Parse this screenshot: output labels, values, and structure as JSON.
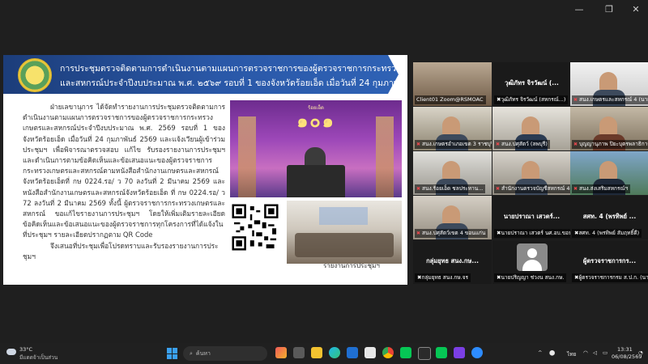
{
  "window": {
    "minimize": "—",
    "maximize": "❐",
    "close": "✕"
  },
  "slide": {
    "banner_line1": "การประชุมตรวจติดตามการดำเนินงานตามแผนการตรวจราชการของผู้ตรวจราชการกระทรวงเกษตร",
    "banner_line2": "และสหกรณ์ประจำปีงบประมาณ พ.ศ. ๒๕๖๙ รอบที่ 1 ของจังหวัดร้อยเอ็ด เมื่อวันที่ 24 กุมภาพันธ์ 2569",
    "paragraphs": [
      "ฝ่ายเลขานุการ ได้จัดทำรายงานการประชุมตรวจติดตามการดำเนินงานตามแผนการตรวจราชการของผู้ตรวจราชการกระทรวงเกษตรและสหกรณ์ประจำปีงบประมาณ พ.ศ. 2569 รอบที่ 1 ของจังหวัดร้อยเอ็ด เมื่อวันที่ 24 กุมภาพันธ์ 2569 และแจ้งเวียนผู้เข้าร่วมประชุมฯ เพื่อพิจารณาตรวจสอบ แก้ไข รับรองรายงานการประชุมฯ และดำเนินการตามข้อคิดเห็นและข้อเสนอแนะของผู้ตรวจราชการกระทรวงเกษตรและสหกรณ์ตามหนังสือสำนักงานเกษตรและสหกรณ์จังหวัดร้อยเอ็ดที่ กษ 0224.รอ/ ว 70 ลงวันที่ 2 มีนาคม 2569 และหนังสือสำนักงานเกษตรและสหกรณ์จังหวัดร้อยเอ็ด ที่ กษ 0224.รอ/ ว 72 ลงวันที่ 2 มีนาคม 2569 ทั้งนี้ ผู้ตรวจราชการกระทรวงเกษตรและสหกรณ์ ขอแก้ไขรายงานการประชุมฯ โดยให้เพิ่มเติมรายละเอียดข้อคิดเห็นและข้อเสนอแนะของผู้ตรวจราชการทุกโครงการที่ได้แจ้งในที่ประชุมฯ รายละเอียดปรากฏตาม QR Code",
      "จึงเสนอที่ประชุมเพื่อโปรดทราบและรับรองรายงานการประชุมฯ"
    ],
    "event_top": "ร้อยเอ็ด",
    "event_number": "๑๐๑",
    "caption": "รายงานการประชุมฯ"
  },
  "tiles": [
    {
      "label": "Client01 Zoom@RSMOAC"
    },
    {
      "label": "วุฒิภัทร จิรวัฒน์ (สหกรณ์...)"
    },
    {
      "label": "สนง.เกษตรและสหกรณ์ 4 (นายปร..."
    },
    {
      "label": "สนง.เกษตรอำเภอเขต 3 ราชบุรี"
    },
    {
      "label": "สนง.ปศุสัตว์ (ลพบุรี)"
    },
    {
      "label": "บุญญานุภาพ ปิยะบุตรพลาธิการ 12"
    },
    {
      "label": "สนง.ร้อยเอ็ด ชลประทาน..."
    },
    {
      "label": "สำนักงานตรวจบัญชีสหกรณ์ 4 ..."
    },
    {
      "label": "สนง.ส่งเสริมสหกรณ์ฯ"
    },
    {
      "label": "สนง.ปศุสัตว์เขต 4 ขอนแก่น"
    }
  ],
  "name_tiles": [
    {
      "top": "วุฒิภัทร จิรวัฒน์ (...",
      "label": "วุฒิภัทร จิรวัฒน์ (สหกรณ์...)"
    },
    {
      "top": "นายปราณา เสวตร์...",
      "label": "นายปราณา เสวตร์ นศ.อบ.ขอนแก่น..."
    },
    {
      "top": "สศท. 4 (พรทิพย์ ...",
      "label": "สศท. 4 (พรทิพย์ สัมฤทธิ์ดี)"
    },
    {
      "top": "กลุ่มยุทธ สนง.กษ...",
      "label": "กลุ่มยุทธ สนง.กษ.จร"
    },
    {
      "top": "",
      "label": "นายปริญญา ช่วงน สนง.กษ."
    },
    {
      "top": "ผู้ตรวจราชการกร...",
      "label": "ผู้ตรวจราชการกรม ส.ป.ก. (นาย..."
    }
  ],
  "taskbar": {
    "weather_temp": "33°C",
    "weather_desc": "มีแดดจ้าเป็นส่วน",
    "search_placeholder": "ค้นหา",
    "lang": "ไทย",
    "time": "13:31",
    "date": "06/08/2569"
  }
}
